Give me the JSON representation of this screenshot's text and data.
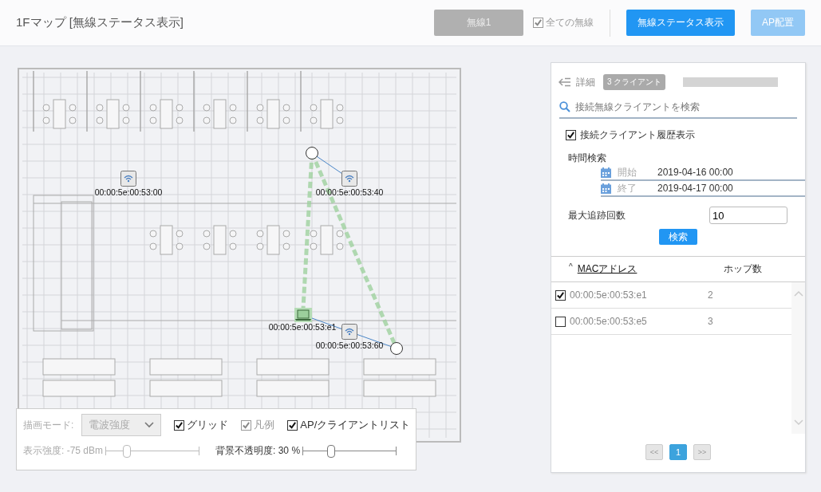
{
  "header": {
    "title": "1Fマップ [無線ステータス表示]",
    "radio_button": {
      "label": "無線1",
      "disabled": true
    },
    "all_radios": {
      "label": "全ての無線",
      "checked": true,
      "disabled": true
    },
    "buttons": [
      {
        "label": "無線ステータス表示",
        "disabled": false
      },
      {
        "label": "AP配置",
        "disabled": true
      }
    ]
  },
  "map": {
    "access_points": [
      {
        "label": "00:00:5e:00:53:00"
      },
      {
        "label": "00:00:5e:00:53:40"
      },
      {
        "label": "00:00:5e:00:53:60"
      }
    ],
    "clients": [
      {
        "label": "00:00:5e:00:53:e1"
      }
    ]
  },
  "map_controls": {
    "draw_mode": {
      "label": "描画モード:",
      "value": "電波強度",
      "disabled": true
    },
    "checkboxes": [
      {
        "label": "グリッド",
        "checked": true,
        "disabled": false
      },
      {
        "label": "凡例",
        "checked": true,
        "disabled": true
      },
      {
        "label": "AP/クライアントリスト",
        "checked": true,
        "disabled": false
      }
    ],
    "sliders": [
      {
        "label": "表示強度: -75 dBm",
        "level": 0.22,
        "disabled": true
      },
      {
        "label": "背景不透明度: 30 %",
        "level": 0.3,
        "disabled": false
      }
    ]
  },
  "detail_panel": {
    "back_label": "詳細",
    "client_badge": "3 クライアント",
    "search": {
      "placeholder": "接続無線クライアントを検索"
    },
    "history": {
      "label": "接続クライアント履歴表示",
      "checked": true
    },
    "time_search_label": "時間検索",
    "time_range": [
      {
        "label": "開始",
        "value": "2019-04-16 00:00"
      },
      {
        "label": "終了",
        "value": "2019-04-17 00:00"
      }
    ],
    "max_trace": {
      "label": "最大追跡回数",
      "value": "10"
    },
    "search_button": "検索",
    "table": {
      "columns": [
        {
          "label": "MACアドレス",
          "sort_icon": "^",
          "sorted": true
        },
        {
          "label": "ホップ数"
        }
      ],
      "rows": [
        {
          "checked": true,
          "mac": "00:00:5e:00:53:e1",
          "hops": "2"
        },
        {
          "checked": false,
          "mac": "00:00:5e:00:53:e5",
          "hops": "3"
        }
      ]
    },
    "pagination": {
      "prev": "<<",
      "pages": [
        {
          "label": "1",
          "selected": true
        }
      ],
      "next": ">>"
    }
  }
}
